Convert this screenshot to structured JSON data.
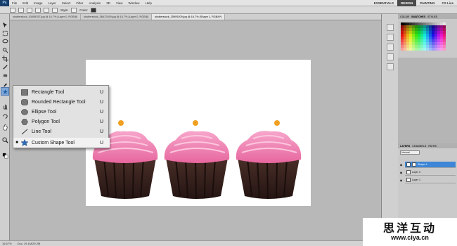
{
  "menubar": {
    "logo": "Ps",
    "items": [
      "File",
      "Edit",
      "Image",
      "Layer",
      "Select",
      "Filter",
      "Analysis",
      "3D",
      "View",
      "Window",
      "Help"
    ],
    "workspaces": [
      "ESSENTIALS",
      "DESIGN",
      "PAINTING"
    ],
    "cs_live": "CS Live"
  },
  "options": {
    "style_label": "Style:",
    "color_label": "Color:"
  },
  "document_tabs": [
    "shutterstock_43459157.jpg @ 16.7% (Layer 0, RGB/8)",
    "shutterstock_36617459.jpg @ 16.7% (Layer 0, RGB/8)",
    "shutterstock_25909209.jpg @ 16.7% (Shape 1, RGB/8*)"
  ],
  "flyout": {
    "items": [
      {
        "name": "Rectangle Tool",
        "key": "U",
        "icon": "rectangle-icon",
        "current": false
      },
      {
        "name": "Rounded Rectangle Tool",
        "key": "U",
        "icon": "rounded-rectangle-icon",
        "current": false
      },
      {
        "name": "Ellipse Tool",
        "key": "U",
        "icon": "ellipse-icon",
        "current": false
      },
      {
        "name": "Polygon Tool",
        "key": "U",
        "icon": "polygon-icon",
        "current": false
      },
      {
        "name": "Line Tool",
        "key": "U",
        "icon": "line-icon",
        "current": false
      },
      {
        "name": "Custom Shape Tool",
        "key": "U",
        "icon": "custom-shape-icon",
        "current": true
      }
    ]
  },
  "panels": {
    "swatch_tabs": [
      "COLOR",
      "SWATCHES",
      "STYLES"
    ],
    "layer_tabs": [
      "LAYERS",
      "CHANNELS",
      "PATHS"
    ],
    "blend_mode": "Normal",
    "layers": [
      {
        "name": "Shape 1",
        "selected": true
      },
      {
        "name": "Layer 0",
        "selected": false
      },
      {
        "name": "Layer 1",
        "selected": false
      }
    ]
  },
  "status": {
    "zoom": "16.67%",
    "doc": "Doc: 19.1M/29.2M"
  },
  "watermark": {
    "cn": "思洋互动",
    "url": "www.ciya.cn"
  },
  "colors": {
    "accent_blue": "#3d86d8",
    "frosting": "#f07fb4",
    "cupcake_liner": "#3a2420",
    "flower_center": "#f0a020"
  }
}
